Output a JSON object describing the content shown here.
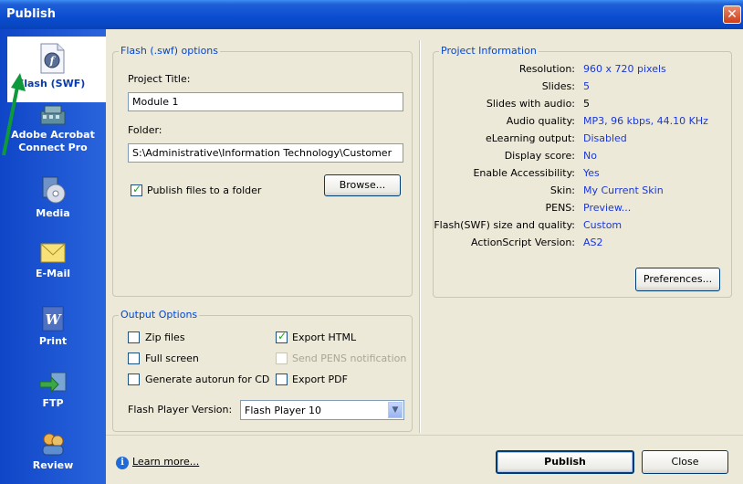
{
  "window": {
    "title": "Publish",
    "close_glyph": "✕"
  },
  "sidebar": {
    "items": [
      {
        "label": "Flash (SWF)",
        "icon": "flash-icon"
      },
      {
        "label": "Adobe Acrobat",
        "label2": "Connect Pro",
        "icon": "connect-pro-icon"
      },
      {
        "label": "Media",
        "icon": "media-icon"
      },
      {
        "label": "E-Mail",
        "icon": "email-icon"
      },
      {
        "label": "Print",
        "icon": "word-print-icon"
      },
      {
        "label": "FTP",
        "icon": "ftp-icon"
      },
      {
        "label": "Review",
        "icon": "review-icon"
      }
    ]
  },
  "flash_options": {
    "legend": "Flash (.swf) options",
    "project_title_label": "Project Title:",
    "project_title_value": "Module 1",
    "folder_label": "Folder:",
    "folder_value": "S:\\Administrative\\Information Technology\\Customer",
    "publish_to_folder_label": "Publish files to a folder",
    "browse_label": "Browse..."
  },
  "output_options": {
    "legend": "Output Options",
    "zip_files": "Zip files",
    "full_screen": "Full screen",
    "generate_autorun": "Generate autorun for CD",
    "export_html": "Export HTML",
    "send_pens": "Send PENS notification",
    "export_pdf": "Export PDF",
    "flash_player_label": "Flash Player Version:",
    "flash_player_value": "Flash Player 10"
  },
  "project_info": {
    "legend": "Project Information",
    "rows": [
      {
        "key": "Resolution:",
        "value": "960 x 720 pixels"
      },
      {
        "key": "Slides:",
        "value": "5"
      },
      {
        "key": "Slides with audio:",
        "value": "5"
      },
      {
        "key": "Audio quality:",
        "value": "MP3, 96 kbps, 44.10 KHz"
      },
      {
        "key": "eLearning output:",
        "value": "Disabled"
      },
      {
        "key": "Display score:",
        "value": "No"
      },
      {
        "key": "Enable Accessibility:",
        "value": "Yes"
      },
      {
        "key": "Skin:",
        "value": "My Current Skin"
      },
      {
        "key": "PENS:",
        "value": "Preview..."
      },
      {
        "key": "Flash(SWF) size and quality:",
        "value": "Custom"
      },
      {
        "key": "ActionScript Version:",
        "value": "AS2"
      }
    ],
    "preferences_label": "Preferences..."
  },
  "footer": {
    "learn_more": "Learn more...",
    "publish_label": "Publish",
    "close_label": "Close"
  },
  "colors": {
    "title_blue": "#0a4cd1",
    "sidebar_blue": "#1a53d0",
    "link_blue": "#1a37d8",
    "legend_blue": "#0046d5",
    "arrow_green": "#0e9a3a"
  }
}
